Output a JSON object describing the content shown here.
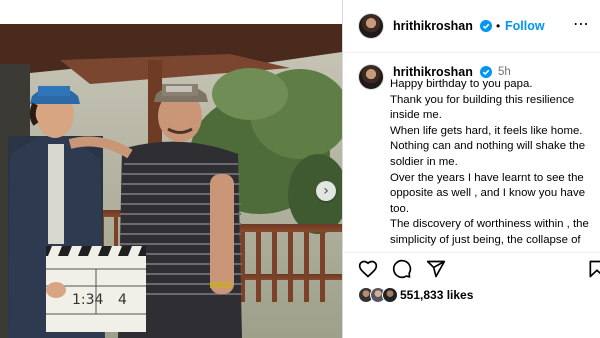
{
  "post": {
    "username": "hrithikroshan",
    "follow_label": "Follow",
    "header_separator": "•",
    "more_icon": "more-horizontal-icon",
    "time_ago": "5h",
    "caption_lines": [
      "Happy birthday to you papa.",
      "Thank you for building this resilience inside me.",
      "When life gets hard, it feels like home. Nothing can and nothing will shake the soldier in me.",
      "Over the years I have learnt to see the opposite as well , and I know you have too.",
      "The discovery of worthiness within , the simplicity of just being, the collapse of"
    ],
    "likes_text": "551,833 likes"
  },
  "photo": {
    "next_icon": "chevron-right-icon",
    "clapperboard_text_1": "1:34",
    "clapperboard_text_2": "4"
  },
  "colors": {
    "accent": "#0095f6",
    "verified": "#0095f6",
    "muted": "#737373"
  },
  "icons": [
    "heart-icon",
    "comment-icon",
    "share-icon",
    "bookmark-icon",
    "verified-badge-icon"
  ]
}
